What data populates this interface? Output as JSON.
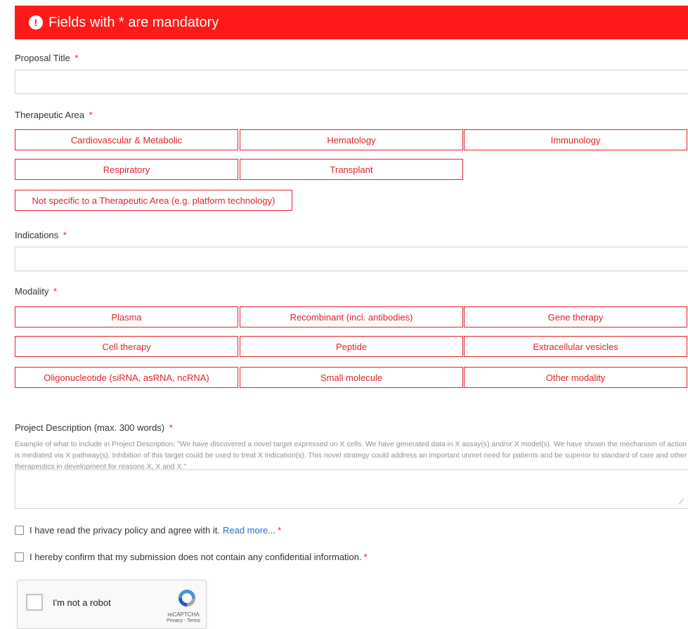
{
  "banner": {
    "icon": "exclamation-circle-icon",
    "text": "Fields with * are mandatory",
    "color": "#ff1a1a"
  },
  "fields": {
    "proposal_title": {
      "label": "Proposal Title",
      "required": "*",
      "value": "",
      "placeholder": ""
    },
    "therapeutic_area": {
      "label": "Therapeutic Area",
      "required": "*",
      "options": [
        "Cardiovascular & Metabolic",
        "Hematology",
        "Immunology",
        "Respiratory",
        "Transplant",
        "Not specific to a Therapeutic Area (e.g. platform technology)"
      ]
    },
    "indications": {
      "label": "Indications",
      "required": "*",
      "value": "",
      "placeholder": ""
    },
    "modality": {
      "label": "Modality",
      "required": "*",
      "options": [
        "Plasma",
        "Recombinant (incl. antibodies)",
        "Gene therapy",
        "Cell therapy",
        "Peptide",
        "Extracellular vesicles",
        "Oligonucleotide (siRNA, asRNA, ncRNA)",
        "Small molecule",
        "Other modality"
      ]
    },
    "project_description": {
      "label": "Project Description (max. 300 words)",
      "required": "*",
      "helper": "Example of what to include in Project Description: \"We have discovered a novel target expressed on X cells. We have generated data in X assay(s) and/or X model(s). We have shown the mechanism of action is mediated via X pathway(s). Inhibition of this target could be used to treat X indication(s). This novel strategy could address an important unmet need for patients and be superior to standard of care and other therapeutics in development for reasons X, X and X.\"",
      "value": ""
    }
  },
  "consent": {
    "privacy": {
      "text": "I have read the privacy policy and agree with it.",
      "link": "Read more...",
      "required": "*"
    },
    "confidential": {
      "text": "I hereby confirm that my submission does not contain any confidential information.",
      "required": "*"
    }
  },
  "recaptcha": {
    "label": "I'm not a robot",
    "brand": "reCAPTCHA",
    "terms": "Privacy - Terms"
  },
  "colors": {
    "accent": "#e3222b",
    "link": "#1f6fcf",
    "border": "#d4d4d4"
  }
}
